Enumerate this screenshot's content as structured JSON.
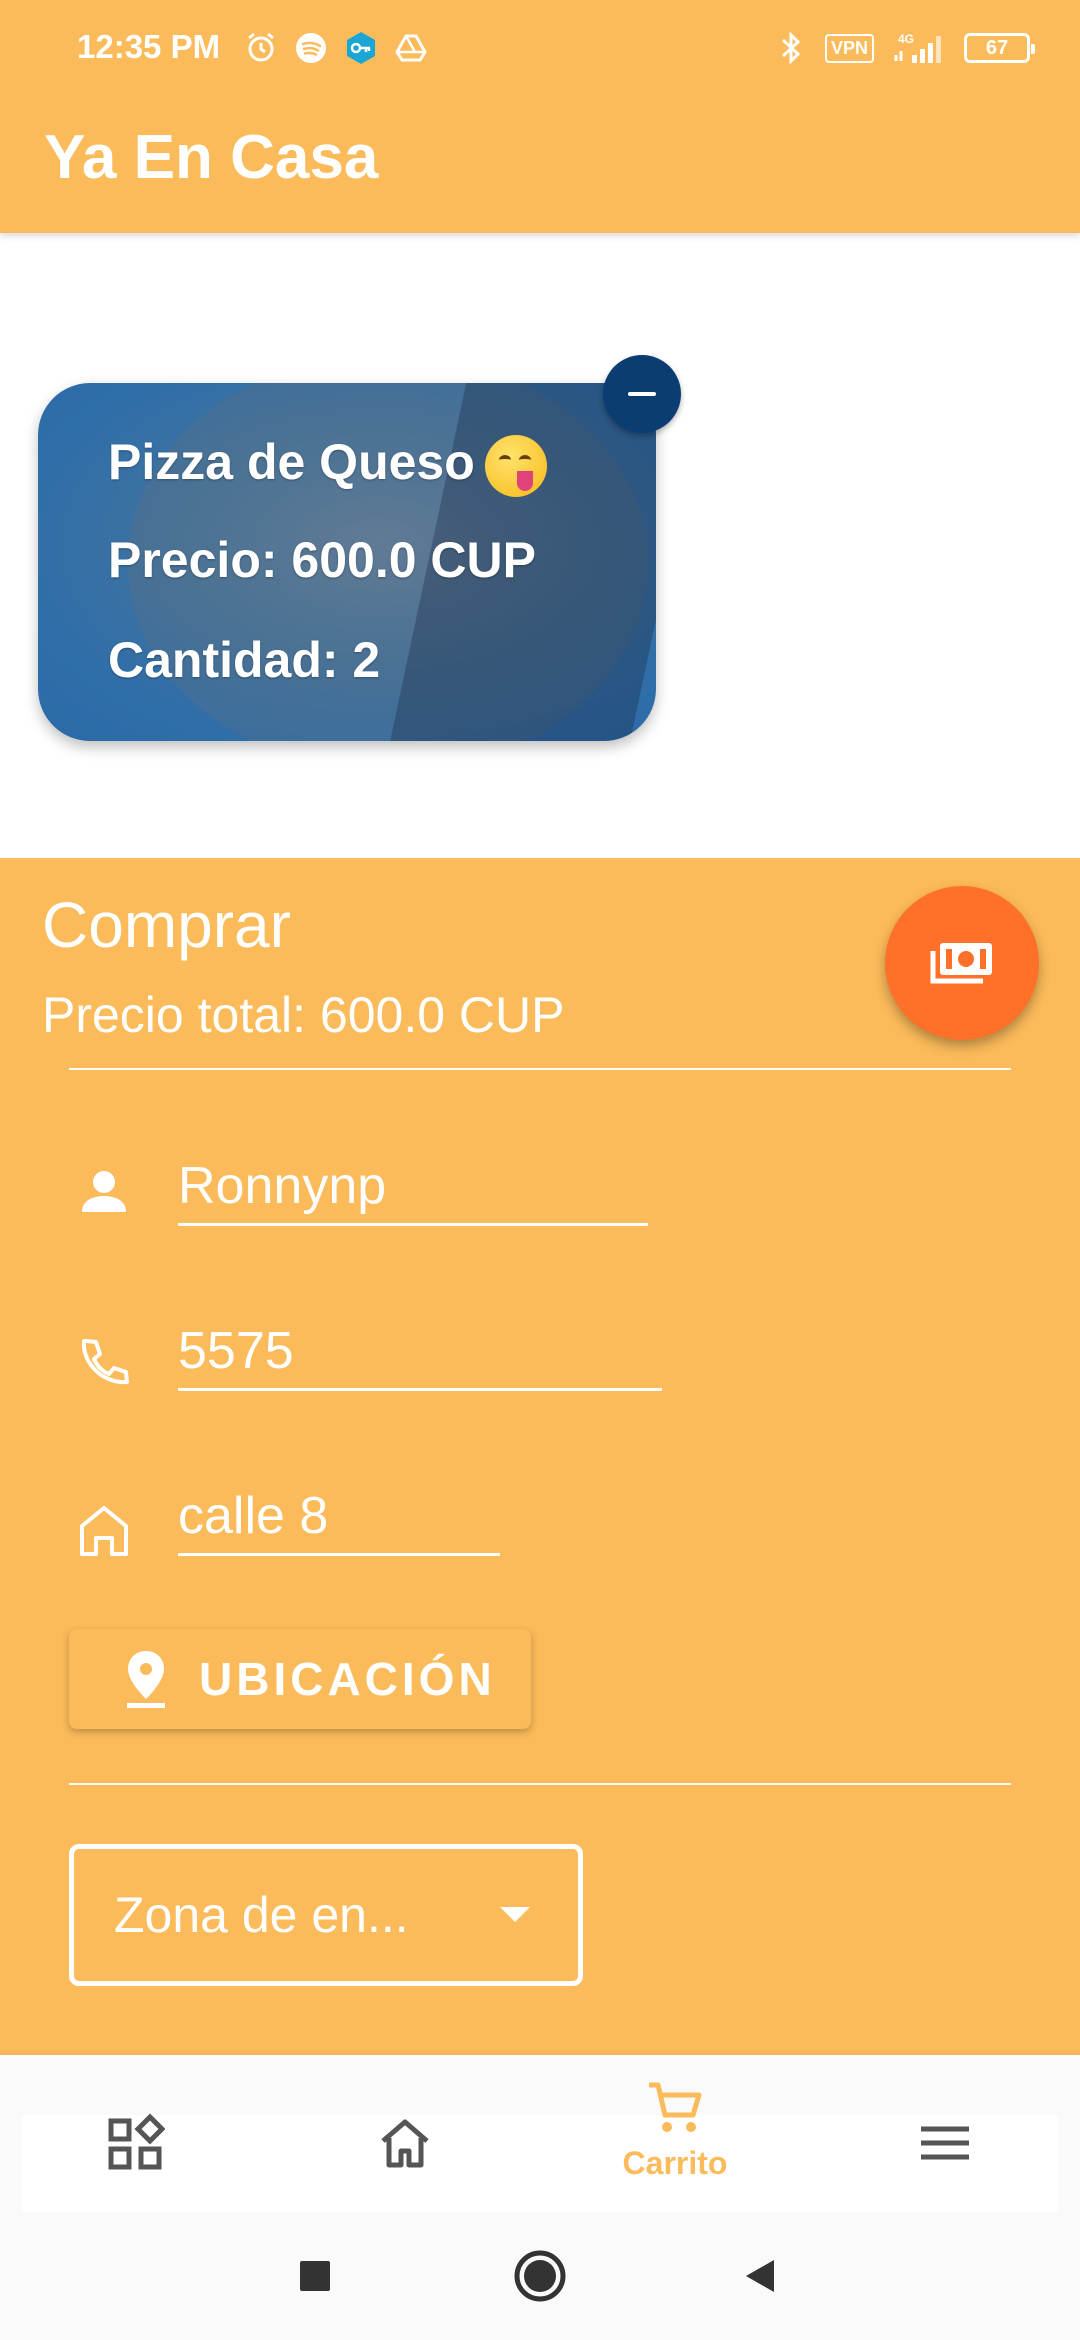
{
  "status_bar": {
    "time": "12:35 PM",
    "left_icons": [
      "alarm-icon",
      "spotify-icon",
      "key-icon",
      "drive-icon"
    ],
    "right_icons": [
      "bluetooth-icon",
      "vpn-icon",
      "signal-icon",
      "battery-icon"
    ],
    "vpn_label": "VPN",
    "network_label": "4G",
    "battery_level": "67"
  },
  "app": {
    "title": "Ya En Casa"
  },
  "cart_item": {
    "name": "Pizza de Queso",
    "emoji": "face-savoring-food-emoji",
    "price_label": "Precio: 600.0 CUP",
    "quantity_label": "Cantidad: 2"
  },
  "checkout": {
    "title": "Comprar",
    "total_label": "Precio total: 600.0 CUP",
    "pay_button_icon": "cash-icon",
    "name_value": "Ronnynp",
    "phone_value": "5575",
    "address_value": "calle 8",
    "location_button_label": "UBICACIÓN",
    "zone_select_value": "Zona de en..."
  },
  "bottom_nav": {
    "items": [
      {
        "icon": "categories-icon",
        "label": ""
      },
      {
        "icon": "home-icon",
        "label": ""
      },
      {
        "icon": "cart-icon",
        "label": "Carrito"
      },
      {
        "icon": "menu-icon",
        "label": ""
      }
    ],
    "active_index": 2
  },
  "colors": {
    "primary": "#FCBB5A",
    "fab": "#FF7028",
    "remove_button": "#0B3C72",
    "nav_icon": "#555555"
  }
}
